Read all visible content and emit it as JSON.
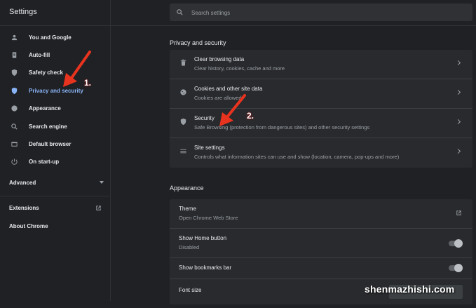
{
  "app": {
    "title": "Settings"
  },
  "search": {
    "placeholder": "Search settings"
  },
  "sidebar": {
    "items": [
      {
        "label": "You and Google",
        "icon": "person-icon",
        "active": false
      },
      {
        "label": "Auto-fill",
        "icon": "clipboard-icon",
        "active": false
      },
      {
        "label": "Safety check",
        "icon": "shield-check-icon",
        "active": false
      },
      {
        "label": "Privacy and security",
        "icon": "shield-icon",
        "active": true
      },
      {
        "label": "Appearance",
        "icon": "palette-icon",
        "active": false
      },
      {
        "label": "Search engine",
        "icon": "search-icon",
        "active": false
      },
      {
        "label": "Default browser",
        "icon": "browser-icon",
        "active": false
      },
      {
        "label": "On start-up",
        "icon": "power-icon",
        "active": false
      }
    ],
    "advanced_label": "Advanced",
    "extensions_label": "Extensions",
    "about_label": "About Chrome"
  },
  "privacy": {
    "title": "Privacy and security",
    "rows": [
      {
        "title": "Clear browsing data",
        "subtitle": "Clear history, cookies, cache and more",
        "icon": "trash-icon"
      },
      {
        "title": "Cookies and other site data",
        "subtitle": "Cookies are allowed",
        "icon": "cookie-icon"
      },
      {
        "title": "Security",
        "subtitle": "Safe Browsing (protection from dangerous sites) and other security settings",
        "icon": "shield-icon"
      },
      {
        "title": "Site settings",
        "subtitle": "Controls what information sites can use and show (location, camera, pop-ups and more)",
        "icon": "tune-icon"
      }
    ]
  },
  "appearance": {
    "title": "Appearance",
    "theme_title": "Theme",
    "theme_subtitle": "Open Chrome Web Store",
    "home_title": "Show Home button",
    "home_subtitle": "Disabled",
    "home_enabled": false,
    "bookmarks_title": "Show bookmarks bar",
    "bookmarks_enabled": false,
    "font_title": "Font size"
  },
  "annotations": {
    "step1": "1.",
    "step2": "2.",
    "arrow_color": "#e8331f"
  },
  "watermark": "shenmazhishi.com"
}
